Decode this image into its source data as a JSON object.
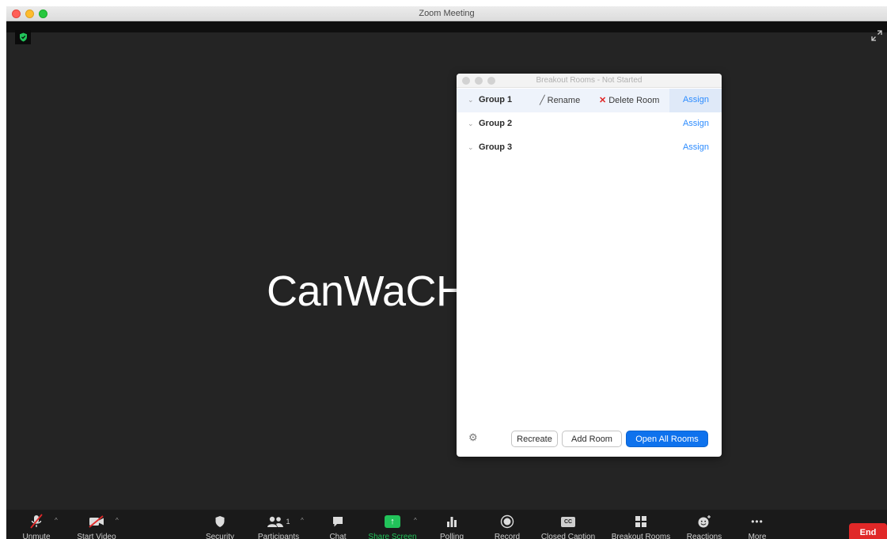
{
  "window": {
    "title": "Zoom Meeting"
  },
  "stage": {
    "participant_name": "CanWaCH"
  },
  "breakout_dialog": {
    "title": "Breakout Rooms - Not Started",
    "groups": [
      {
        "name": "Group 1",
        "rename_label": "Rename",
        "delete_label": "Delete Room",
        "assign_label": "Assign"
      },
      {
        "name": "Group 2",
        "assign_label": "Assign"
      },
      {
        "name": "Group 3",
        "assign_label": "Assign"
      }
    ],
    "footer": {
      "recreate_label": "Recreate",
      "add_room_label": "Add Room",
      "open_all_label": "Open All Rooms"
    }
  },
  "toolbar": {
    "unmute": "Unmute",
    "start_video": "Start Video",
    "security": "Security",
    "participants": "Participants",
    "participants_count": "1",
    "chat": "Chat",
    "share_screen": "Share Screen",
    "polling": "Polling",
    "record": "Record",
    "closed_caption": "Closed Caption",
    "cc_badge": "CC",
    "breakout_rooms": "Breakout Rooms",
    "reactions": "Reactions",
    "more": "More",
    "end": "End"
  },
  "colors": {
    "accent_blue": "#0e72ed",
    "link_blue": "#2d8cff",
    "end_red": "#e02828",
    "share_green": "#22c35a",
    "security_green": "#21c35a"
  }
}
